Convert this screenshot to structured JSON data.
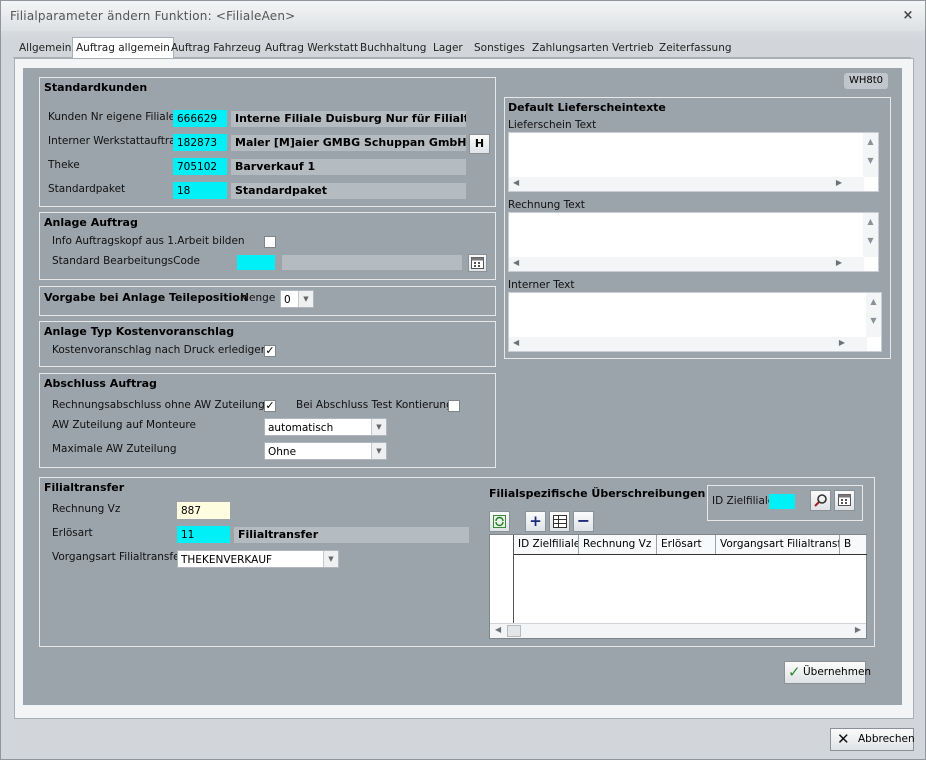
{
  "window": {
    "title": "Filialparameter ändern   Funktion: <FilialeAen>",
    "close_glyph": "×"
  },
  "tabs": [
    "Allgemein",
    "Auftrag allgemein",
    "Auftrag Fahrzeug",
    "Auftrag Werkstatt",
    "Buchhaltung",
    "Lager",
    "Sonstiges",
    "Zahlungsarten",
    "Vertrieb",
    "Zeiterfassung"
  ],
  "active_tab": "Auftrag allgemein",
  "badge": "WH8t0",
  "standardkunden": {
    "title": "Standardkunden",
    "rows": [
      {
        "label": "Kunden Nr eigene Filiale",
        "value": "666629",
        "desc": "Interne Filiale Duisburg Nur für Filialt"
      },
      {
        "label": "Interner Werkstattauftrag",
        "value": "182873",
        "desc": "Maler [M]aier GMBG Schuppan GmbH"
      },
      {
        "label": "Theke",
        "value": "705102",
        "desc": "Barverkauf 1"
      },
      {
        "label": "Standardpaket",
        "value": "18",
        "desc": "Standardpaket"
      }
    ],
    "h_button": "H"
  },
  "anlage_auftrag": {
    "title": "Anlage Auftrag",
    "info_label": "Info Auftragskopf aus 1.Arbeit bilden",
    "info_checked": false,
    "code_label": "Standard BearbeitungsCode",
    "code_value": ""
  },
  "vorgabe": {
    "title": "Vorgabe bei Anlage Teileposition",
    "menge_label": "Menge",
    "menge_value": "0"
  },
  "kostenvoranschlag": {
    "title": "Anlage Typ Kostenvoranschlag",
    "label": "Kostenvoranschlag nach Druck erledigen",
    "checked": true
  },
  "abschluss": {
    "title": "Abschluss Auftrag",
    "rechnung_label": "Rechnungsabschluss ohne AW Zuteilung",
    "rechnung_checked": true,
    "test_label": "Bei Abschluss Test Kontierung",
    "test_checked": false,
    "aw_label": "AW Zuteilung auf Monteure",
    "aw_value": "automatisch",
    "max_label": "Maximale AW Zuteilung",
    "max_value": "Ohne"
  },
  "lieferschein": {
    "title": "Default Lieferscheintexte",
    "memos": [
      {
        "label": "Lieferschein Text",
        "value": ""
      },
      {
        "label": "Rechnung Text",
        "value": ""
      },
      {
        "label": "Interner Text",
        "value": ""
      }
    ]
  },
  "filialtransfer": {
    "title": "Filialtransfer",
    "rechnung_label": "Rechnung Vz",
    "rechnung_value": "887",
    "erloes_label": "Erlösart",
    "erloes_value": "11",
    "erloes_desc": "Filialtransfer",
    "vorgang_label": "Vorgangsart Filialtransfer",
    "vorgang_value": "THEKENVERKAUF"
  },
  "ueberschreibungen": {
    "title": "Filialspezifische Überschreibungen",
    "zielfiliale_label": "ID Zielfiliale",
    "zielfiliale_value": "",
    "columns": [
      "ID Zielfiliale",
      "Rechnung Vz",
      "Erlösart",
      "Vorgangsart Filialtransfer",
      "B"
    ],
    "rows": []
  },
  "buttons": {
    "apply": "Übernehmen",
    "cancel": "Abbrechen"
  },
  "colors": {
    "panel": "#9ca4ab",
    "lookup_field": "#00f0f8",
    "input_field": "#fffde0"
  }
}
